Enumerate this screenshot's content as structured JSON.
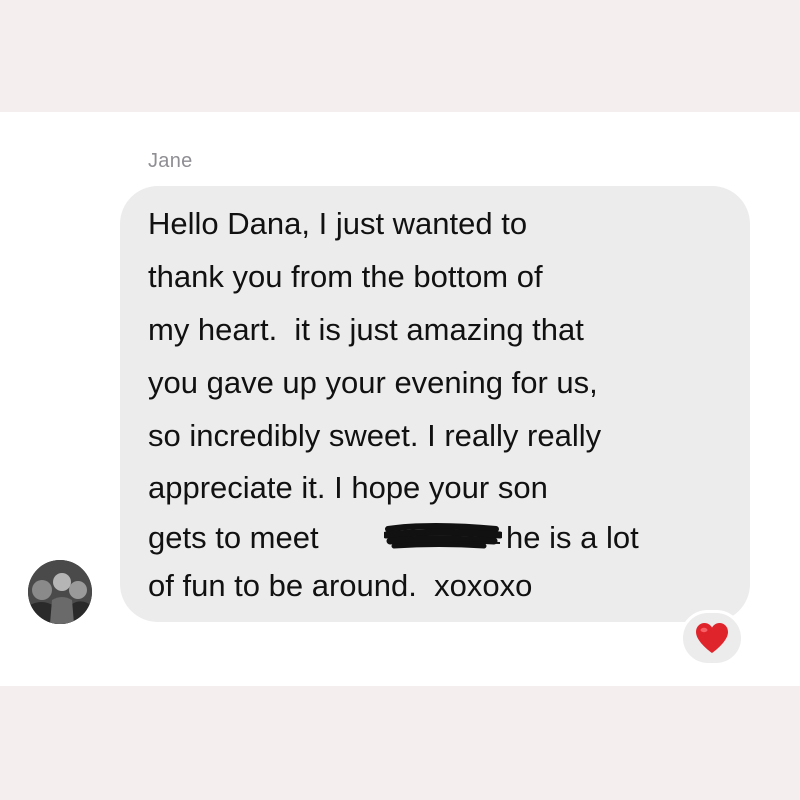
{
  "conversation": {
    "sender_name": "Jane",
    "message": {
      "lines": [
        "Hello Dana, I just wanted to",
        "thank you from the bottom of",
        "my heart.  it is just amazing that",
        "you gave up your evening for us,",
        "so incredibly sweet. I really really",
        "appreciate it. I hope your son",
        "gets to meet",
        "he is a lot",
        "of fun to be around.  xoxoxo"
      ]
    },
    "reaction": {
      "icon": "heart-icon",
      "color": "#e0242b"
    }
  }
}
